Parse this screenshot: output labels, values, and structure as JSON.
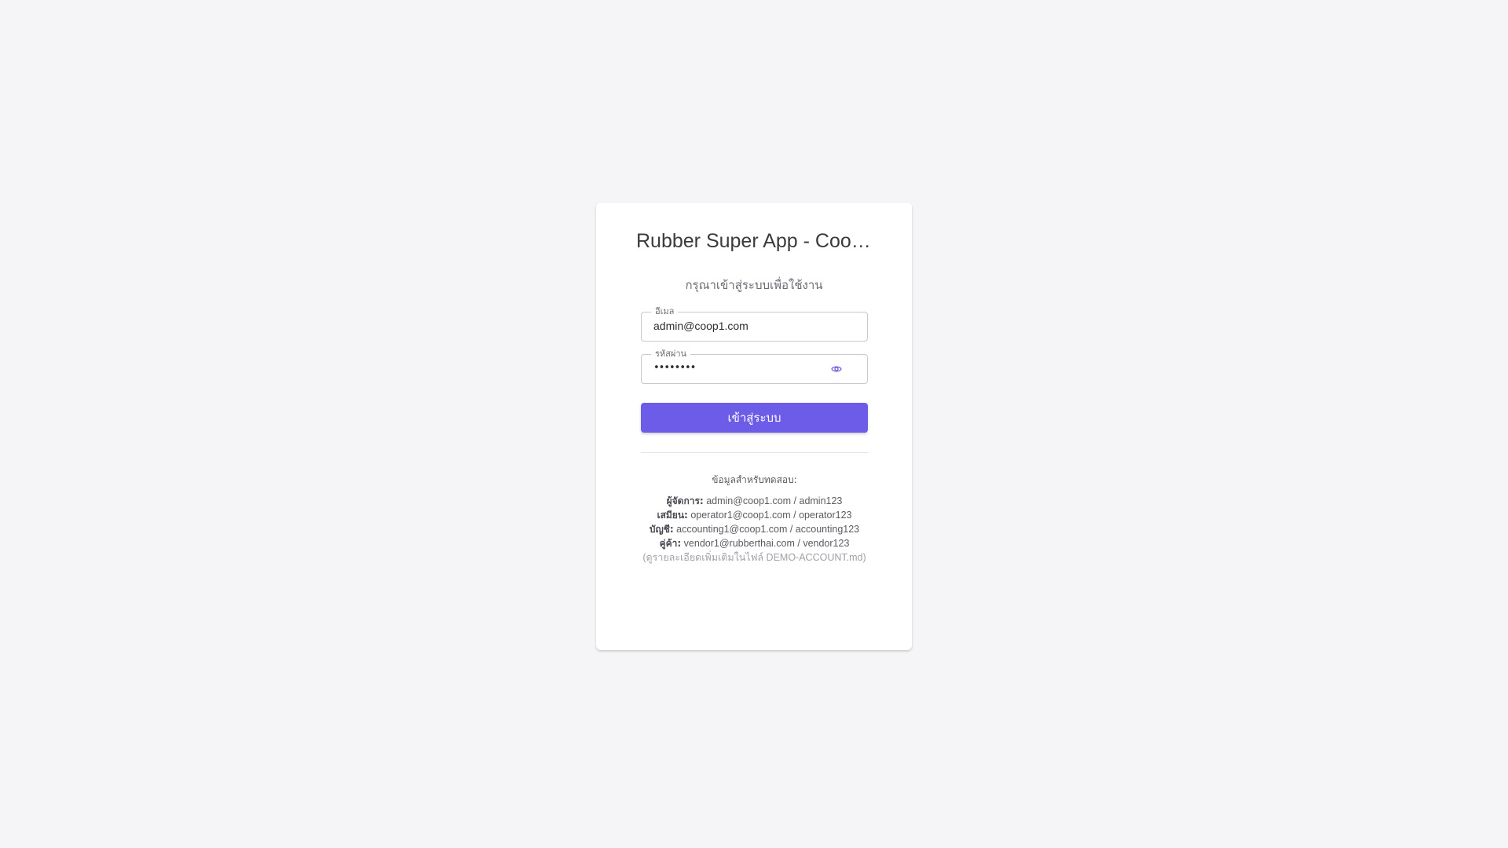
{
  "title": "Rubber Super App - Coop…",
  "subtitle": "กรุณาเข้าสู่ระบบเพื่อใช้งาน",
  "email_field": {
    "label": "อีเมล",
    "value": "admin@coop1.com"
  },
  "password_field": {
    "label": "รหัสผ่าน",
    "value": "••••••••"
  },
  "login_button": "เข้าสู่ระบบ",
  "demo": {
    "heading": "ข้อมูลสำหรับทดสอบ:",
    "accounts": [
      {
        "role": "ผู้จัดการ:",
        "credentials": "admin@coop1.com / admin123"
      },
      {
        "role": "เสมียน:",
        "credentials": "operator1@coop1.com / operator123"
      },
      {
        "role": "บัญชี:",
        "credentials": "accounting1@coop1.com / accounting123"
      },
      {
        "role": "คู่ค้า:",
        "credentials": "vendor1@rubberthai.com / vendor123"
      }
    ],
    "note": "(ดูรายละเอียดเพิ่มเติมในไฟล์ DEMO-ACCOUNT.md)"
  },
  "colors": {
    "accent": "#6c5ce7",
    "background": "#f5f5f7"
  },
  "icons": {
    "password_toggle": "eye-icon"
  }
}
